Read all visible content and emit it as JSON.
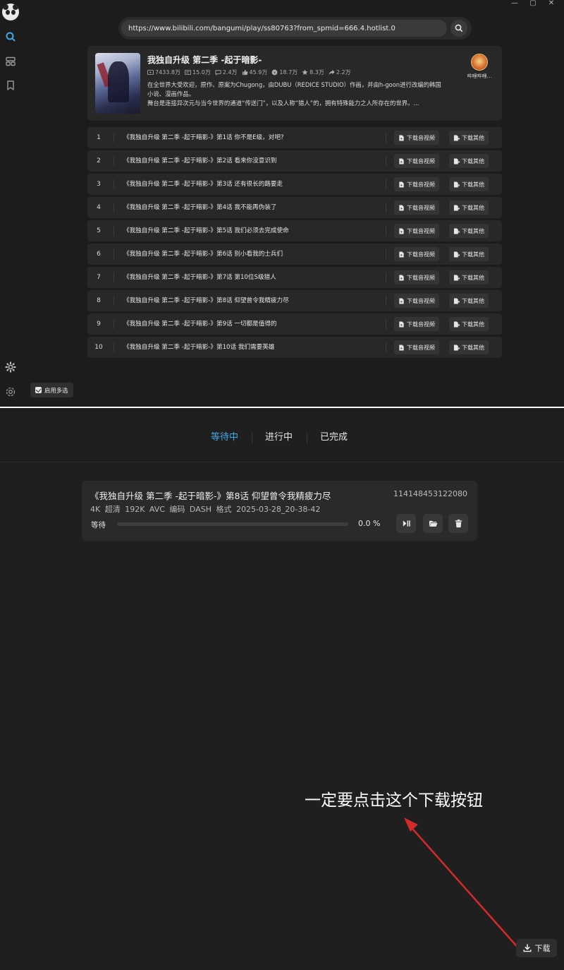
{
  "window": {
    "minimize_glyph": "—",
    "maximize_glyph": "▢",
    "close_glyph": "✕"
  },
  "search": {
    "url_value": "https://www.bilibili.com/bangumi/play/ss80763?from_spmid=666.4.hotlist.0",
    "icon": "search-icon"
  },
  "sidebar": {
    "items": [
      "search-icon",
      "layers-icon",
      "bookmark-icon"
    ],
    "bottom_items": [
      "gear-icon",
      "settings-icon"
    ]
  },
  "info": {
    "title": "我独自升级 第二季 -起于暗影-",
    "stats": {
      "views": "7433.8万",
      "danmaku": "15.0万",
      "comments": "2.4万",
      "likes": "45.9万",
      "coins": "18.7万",
      "favorites": "8.3万",
      "shares": "2.2万"
    },
    "description_line1": "在全世界大受欢迎，原作、原案为Chugong，由DUBU（REDICE STUDIO）作画，并由h-goon进行改编的韩国小说、漫画作品。",
    "description_line2": "舞台是连接异次元与当今世界的通道“传送门”，以及人称“猎人”的，拥有特殊能力之人所存在的世界。...",
    "uploader": "哔哩哔哩..."
  },
  "episodes": [
    {
      "num": "1",
      "title": "《我独自升级 第二季 -起于暗影-》第1话 你不是E级，对吧?"
    },
    {
      "num": "2",
      "title": "《我独自升级 第二季 -起于暗影-》第2话 看来你没意识到"
    },
    {
      "num": "3",
      "title": "《我独自升级 第二季 -起于暗影-》第3话 还有很长的路要走"
    },
    {
      "num": "4",
      "title": "《我独自升级 第二季 -起于暗影-》第4话 我不能再伪装了"
    },
    {
      "num": "5",
      "title": "《我独自升级 第二季 -起于暗影-》第5话 我们必须去完成使命"
    },
    {
      "num": "6",
      "title": "《我独自升级 第二季 -起于暗影-》第6话 别小看我的士兵们"
    },
    {
      "num": "7",
      "title": "《我独自升级 第二季 -起于暗影-》第7话 第10位S级猎人"
    },
    {
      "num": "8",
      "title": "《我独自升级 第二季 -起于暗影-》第8话 仰望曾令我精疲力尽"
    },
    {
      "num": "9",
      "title": "《我独自升级 第二季 -起于暗影-》第9话 一切都是值得的"
    },
    {
      "num": "10",
      "title": "《我独自升级 第二季 -起于暗影-》第10话 我们需要英雄"
    }
  ],
  "episode_buttons": {
    "download_av": "下载音视频",
    "download_other": "下载其他"
  },
  "multi_select_label": "启用多选",
  "tabs": {
    "waiting": "等待中",
    "in_progress": "进行中",
    "completed": "已完成",
    "active_color": "#3fa9e6"
  },
  "task": {
    "title": "《我独自升级 第二季 -起于暗影-》第8话 仰望曾令我精疲力尽",
    "id": "114148453122080",
    "meta": "4K 超清  192K  AVC 编码  DASH 格式  2025-03-28_20-38-42",
    "status": "等待",
    "progress_percent": 0.0,
    "progress_text": "0.0 %"
  },
  "annotation_text": "一定要点击这个下载按钮",
  "download_button_label": "下载",
  "colors": {
    "accent": "#3fa9e6",
    "arrow": "#d42a2a"
  }
}
